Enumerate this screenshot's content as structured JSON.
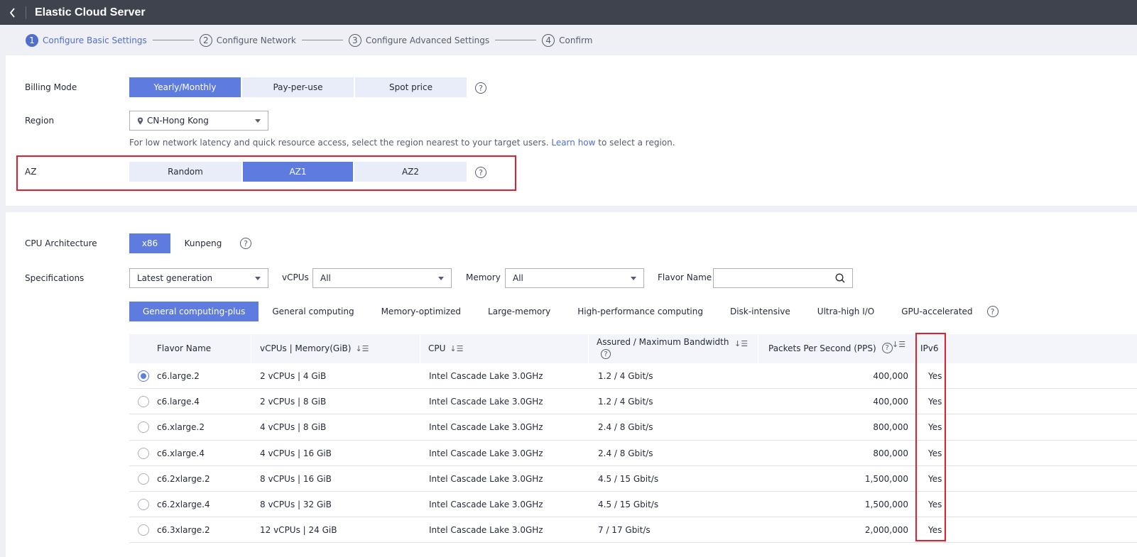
{
  "header": {
    "title": "Elastic Cloud Server"
  },
  "steps": [
    {
      "num": "1",
      "label": "Configure Basic Settings"
    },
    {
      "num": "2",
      "label": "Configure Network"
    },
    {
      "num": "3",
      "label": "Configure Advanced Settings"
    },
    {
      "num": "4",
      "label": "Confirm"
    }
  ],
  "billing": {
    "label": "Billing Mode",
    "options": [
      "Yearly/Monthly",
      "Pay-per-use",
      "Spot price"
    ],
    "selected": "Yearly/Monthly"
  },
  "region": {
    "label": "Region",
    "value": "CN-Hong Kong",
    "hint_before": "For low network latency and quick resource access, select the region nearest to your target users.",
    "hint_link": "Learn how",
    "hint_after": "to select a region."
  },
  "az": {
    "label": "AZ",
    "options": [
      "Random",
      "AZ1",
      "AZ2"
    ],
    "selected": "AZ1"
  },
  "cpu_arch": {
    "label": "CPU Architecture",
    "options": [
      "x86",
      "Kunpeng"
    ],
    "selected": "x86"
  },
  "specs": {
    "label": "Specifications",
    "generation": "Latest generation",
    "vcpus_label": "vCPUs",
    "vcpus_value": "All",
    "memory_label": "Memory",
    "memory_value": "All",
    "flavor_label": "Flavor Name",
    "flavor_value": ""
  },
  "spec_tabs": [
    "General computing-plus",
    "General computing",
    "Memory-optimized",
    "Large-memory",
    "High-performance computing",
    "Disk-intensive",
    "Ultra-high I/O",
    "GPU-accelerated"
  ],
  "table": {
    "headers": {
      "flavor": "Flavor Name",
      "vcpu_mem": "vCPUs | Memory(GiB)",
      "cpu": "CPU",
      "bandwidth": "Assured / Maximum Bandwidth",
      "pps": "Packets Per Second (PPS)",
      "ipv6": "IPv6"
    },
    "rows": [
      {
        "flavor": "c6.large.2",
        "vcpu_mem": "2 vCPUs | 4 GiB",
        "cpu": "Intel Cascade Lake 3.0GHz",
        "bandwidth": "1.2 / 4 Gbit/s",
        "pps": "400,000",
        "ipv6": "Yes",
        "selected": true
      },
      {
        "flavor": "c6.large.4",
        "vcpu_mem": "2 vCPUs | 8 GiB",
        "cpu": "Intel Cascade Lake 3.0GHz",
        "bandwidth": "1.2 / 4 Gbit/s",
        "pps": "400,000",
        "ipv6": "Yes",
        "selected": false
      },
      {
        "flavor": "c6.xlarge.2",
        "vcpu_mem": "4 vCPUs | 8 GiB",
        "cpu": "Intel Cascade Lake 3.0GHz",
        "bandwidth": "2.4 / 8 Gbit/s",
        "pps": "800,000",
        "ipv6": "Yes",
        "selected": false
      },
      {
        "flavor": "c6.xlarge.4",
        "vcpu_mem": "4 vCPUs | 16 GiB",
        "cpu": "Intel Cascade Lake 3.0GHz",
        "bandwidth": "2.4 / 8 Gbit/s",
        "pps": "800,000",
        "ipv6": "Yes",
        "selected": false
      },
      {
        "flavor": "c6.2xlarge.2",
        "vcpu_mem": "8 vCPUs | 16 GiB",
        "cpu": "Intel Cascade Lake 3.0GHz",
        "bandwidth": "4.5 / 15 Gbit/s",
        "pps": "1,500,000",
        "ipv6": "Yes",
        "selected": false
      },
      {
        "flavor": "c6.2xlarge.4",
        "vcpu_mem": "8 vCPUs | 32 GiB",
        "cpu": "Intel Cascade Lake 3.0GHz",
        "bandwidth": "4.5 / 15 Gbit/s",
        "pps": "1,500,000",
        "ipv6": "Yes",
        "selected": false
      },
      {
        "flavor": "c6.3xlarge.2",
        "vcpu_mem": "12 vCPUs | 24 GiB",
        "cpu": "Intel Cascade Lake 3.0GHz",
        "bandwidth": "7 / 17 Gbit/s",
        "pps": "2,000,000",
        "ipv6": "Yes",
        "selected": false
      }
    ]
  },
  "colors": {
    "accent": "#5e7ce0",
    "highlight_box": "#e0202a",
    "topbar": "#3f434e"
  }
}
